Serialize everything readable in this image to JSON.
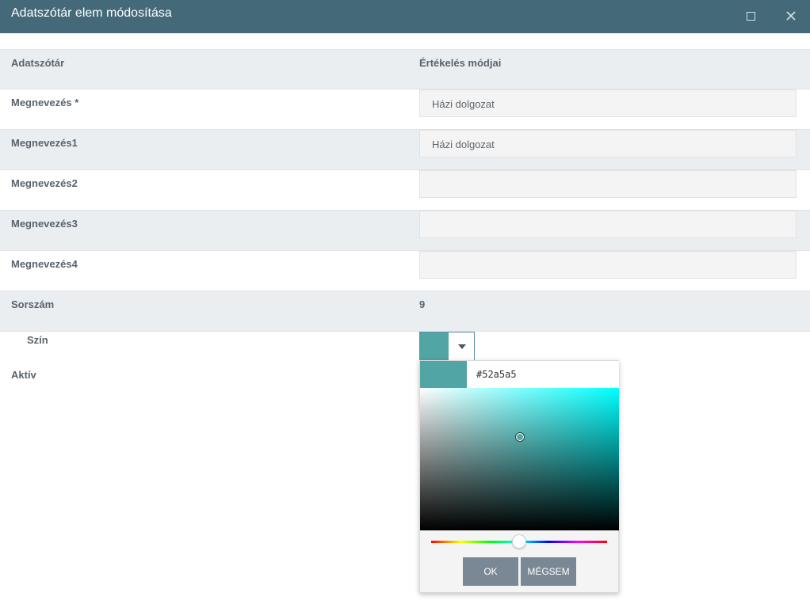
{
  "window": {
    "title": "Adatszótár elem módosítása"
  },
  "rows": {
    "header": {
      "label": "Adatszótár",
      "value": "Értékelés módjai"
    },
    "megnevezes": {
      "label": "Megnevezés *",
      "value": "Házi dolgozat"
    },
    "megnevezes1": {
      "label": "Megnevezés1",
      "value": "Házi dolgozat"
    },
    "megnevezes2": {
      "label": "Megnevezés2",
      "value": ""
    },
    "megnevezes3": {
      "label": "Megnevezés3",
      "value": ""
    },
    "megnevezes4": {
      "label": "Megnevezés4",
      "value": ""
    },
    "sorszam": {
      "label": "Sorszám",
      "value": "9"
    },
    "szin": {
      "label": "Szín"
    },
    "aktiv": {
      "label": "Aktív"
    }
  },
  "color_picker": {
    "current_color": "#52a5a5",
    "hex_value": "#52a5a5",
    "hue_color": "#00ffff",
    "ok_label": "OK",
    "cancel_label": "MÉGSEM"
  },
  "colors": {
    "titlebar": "#446a7a",
    "row_alt": "#ebeef1",
    "button": "#7a8895"
  },
  "icons": {
    "maximize": "square-outline-icon",
    "close": "close-icon",
    "dropdown": "chevron-down-icon"
  }
}
